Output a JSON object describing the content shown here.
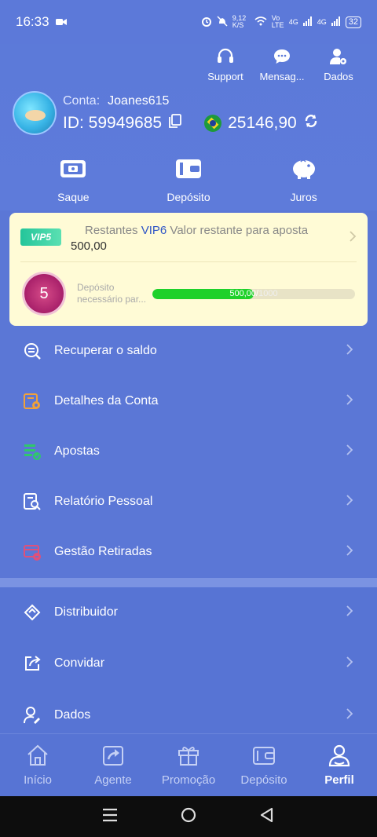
{
  "statusbar": {
    "time": "16:33",
    "net_speed": "9,12 K/S",
    "net_type": "Vo LTE",
    "sig1": "4G",
    "sig2": "4G",
    "battery": "32"
  },
  "top_actions": [
    {
      "label": "Support",
      "icon": "headset-icon"
    },
    {
      "label": "Mensag...",
      "icon": "message-icon"
    },
    {
      "label": "Dados",
      "icon": "user-settings-icon"
    }
  ],
  "profile": {
    "conta_label": "Conta:",
    "username": "Joanes615",
    "id_text": "ID: 59949685",
    "balance": "25146,90"
  },
  "quick_actions": [
    {
      "label": "Saque",
      "icon": "withdraw-icon"
    },
    {
      "label": "Depósito",
      "icon": "wallet-icon"
    },
    {
      "label": "Juros",
      "icon": "piggy-bank-icon"
    }
  ],
  "vip": {
    "badge": "VIP5",
    "restantes_label": "Restantes",
    "next_level": "VIP6",
    "valor_label": "Valor restante para aposta",
    "remaining": "500,00",
    "medal_level": "5",
    "req_line1": "Depósito",
    "req_line2": "necessário par...",
    "progress_current": "500,00",
    "progress_max": "1000",
    "progress_fraction": 0.5
  },
  "menu1": [
    {
      "label": "Recuperar o saldo",
      "icon": "recover-balance-icon",
      "color": "#ffffff"
    },
    {
      "label": "Detalhes da Conta",
      "icon": "account-details-icon",
      "color": "#f0a13a"
    },
    {
      "label": "Apostas",
      "icon": "bets-icon",
      "color": "#2fc86b"
    },
    {
      "label": "Relatório Pessoal",
      "icon": "report-icon",
      "color": "#ffffff"
    },
    {
      "label": "Gestão Retiradas",
      "icon": "withdrawals-icon",
      "color": "#e0507a"
    }
  ],
  "menu2": [
    {
      "label": "Distribuidor",
      "icon": "distributor-icon"
    },
    {
      "label": "Convidar",
      "icon": "invite-icon"
    },
    {
      "label": "Dados",
      "icon": "user-data-icon"
    }
  ],
  "bottom_nav": [
    {
      "label": "Início",
      "icon": "home-icon",
      "active": false
    },
    {
      "label": "Agente",
      "icon": "share-icon",
      "active": false
    },
    {
      "label": "Promoção",
      "icon": "gift-icon",
      "active": false
    },
    {
      "label": "Depósito",
      "icon": "wallet-icon",
      "active": false
    },
    {
      "label": "Perfil",
      "icon": "profile-icon",
      "active": true
    }
  ]
}
